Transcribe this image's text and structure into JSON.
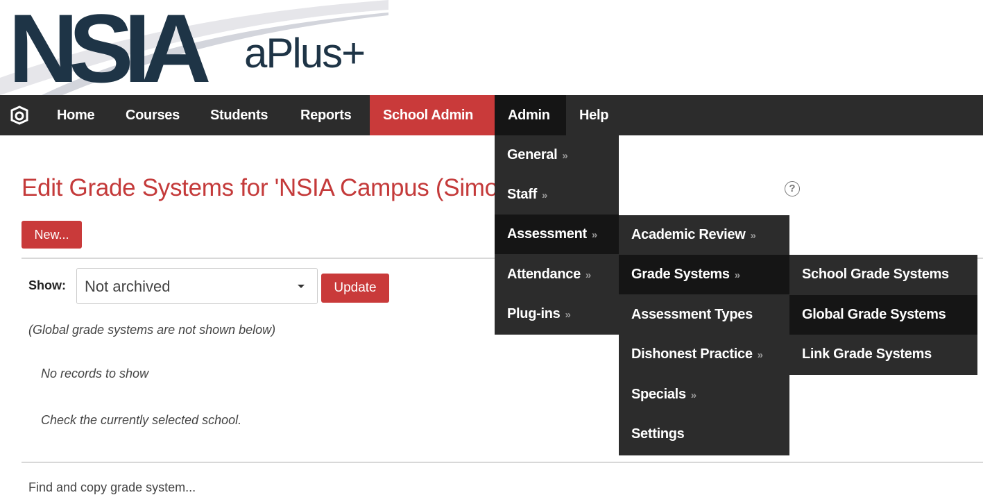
{
  "header": {
    "logo_text": "NSIA",
    "product_text": "aPlus+"
  },
  "nav": {
    "items": [
      {
        "label": "Home"
      },
      {
        "label": "Courses"
      },
      {
        "label": "Students"
      },
      {
        "label": "Reports"
      },
      {
        "label": "School Admin"
      },
      {
        "label": "Admin"
      },
      {
        "label": "Help"
      }
    ]
  },
  "page": {
    "title": "Edit Grade Systems for 'NSIA Campus (Simonds Street)'",
    "help_glyph": "?",
    "new_button": "New...",
    "show_label": "Show:",
    "show_select_value": "Not archived",
    "update_button": "Update",
    "global_note": "(Global grade systems are not shown below)",
    "no_records": "No records to show",
    "check_school": "Check the currently selected school.",
    "find_copy_link": "Find and copy grade system..."
  },
  "menus": {
    "submenu_glyph": "»",
    "admin": {
      "items": [
        {
          "label": "General",
          "has_submenu": true
        },
        {
          "label": "Staff",
          "has_submenu": true
        },
        {
          "label": "Assessment",
          "has_submenu": true,
          "active": true
        },
        {
          "label": "Attendance",
          "has_submenu": true
        },
        {
          "label": "Plug-ins",
          "has_submenu": true
        }
      ]
    },
    "assessment": {
      "items": [
        {
          "label": "Academic Review",
          "has_submenu": true
        },
        {
          "label": "Grade Systems",
          "has_submenu": true,
          "active": true
        },
        {
          "label": "Assessment Types",
          "has_submenu": false
        },
        {
          "label": "Dishonest Practice",
          "has_submenu": true
        },
        {
          "label": "Specials",
          "has_submenu": true
        },
        {
          "label": "Settings",
          "has_submenu": false
        }
      ]
    },
    "grade_systems": {
      "items": [
        {
          "label": "School Grade Systems",
          "has_submenu": false
        },
        {
          "label": "Global Grade Systems",
          "has_submenu": false,
          "active": true
        },
        {
          "label": "Link Grade Systems",
          "has_submenu": false
        }
      ]
    }
  },
  "colors": {
    "nav_bg": "#2c2c2c",
    "nav_active": "#151515",
    "accent_red": "#c93a3a",
    "title_red": "#c43a3a",
    "logo_navy": "#1e3446"
  }
}
